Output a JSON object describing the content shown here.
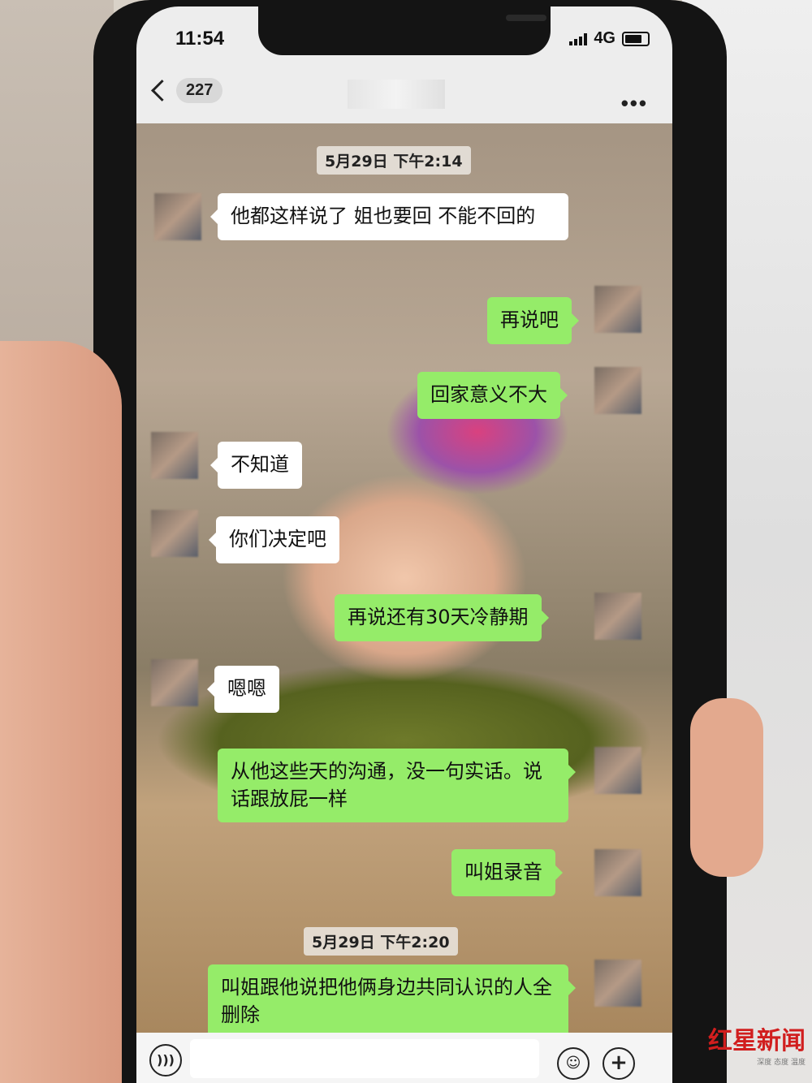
{
  "status": {
    "time": "11:54",
    "network": "4G"
  },
  "header": {
    "unread_count": "227",
    "more_icon": "•••"
  },
  "messages": [
    {
      "type": "timestamp",
      "text": "5月29日 下午2:14"
    },
    {
      "type": "in",
      "text": "他都这样说了 姐也要回 不能不回的"
    },
    {
      "type": "out",
      "text": "再说吧"
    },
    {
      "type": "out",
      "text": "回家意义不大"
    },
    {
      "type": "in",
      "text": "不知道"
    },
    {
      "type": "in",
      "text": "你们决定吧"
    },
    {
      "type": "out",
      "text": "再说还有30天冷静期"
    },
    {
      "type": "in",
      "text": "嗯嗯"
    },
    {
      "type": "out",
      "text": "从他这些天的沟通，没一句实话。说话跟放屁一样"
    },
    {
      "type": "out",
      "text": "叫姐录音"
    },
    {
      "type": "timestamp",
      "text": "5月29日 下午2:20"
    },
    {
      "type": "out",
      "text": "叫姐跟他说把他俩身边共同认识的人全删除"
    }
  ],
  "input_bar": {
    "voice_icon": "voice-icon",
    "emoji_icon": "emoji-icon",
    "plus_icon": "plus-icon"
  },
  "watermark": {
    "logo": "红星新闻",
    "sub": "深度 态度 温度"
  },
  "colors": {
    "out_bubble": "#95ec69",
    "in_bubble": "#ffffff",
    "watermark": "#d11e1e"
  }
}
